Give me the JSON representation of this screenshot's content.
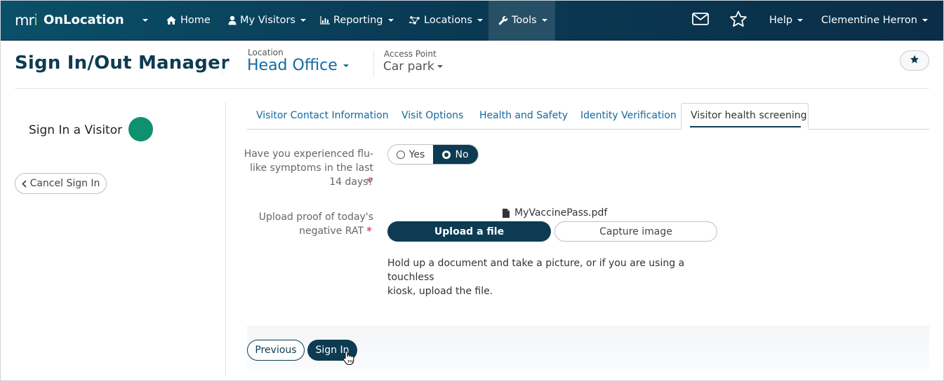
{
  "navbar": {
    "logo_text": "mri",
    "brand": "OnLocation",
    "items": [
      {
        "label": "Home",
        "icon": "home-icon"
      },
      {
        "label": "My Visitors",
        "icon": "user-icon"
      },
      {
        "label": "Reporting",
        "icon": "bar-chart-icon"
      },
      {
        "label": "Locations",
        "icon": "network-icon"
      },
      {
        "label": "Tools",
        "icon": "wrench-icon"
      }
    ],
    "help_label": "Help",
    "user_name": "Clementine Herron",
    "colors": {
      "bar_start": "#0a5068",
      "bar_end": "#0b2e48",
      "logo_accent": "#9cc65a"
    }
  },
  "header": {
    "title": "Sign In/Out Manager",
    "location_label": "Location",
    "location_value": "Head Office",
    "access_point_label": "Access Point",
    "access_point_value": "Car park",
    "favorite_icon": "star-icon"
  },
  "left_panel": {
    "heading": "Sign In a Visitor",
    "status_color": "#0f9170",
    "cancel_label": "Cancel Sign In"
  },
  "tabs": [
    {
      "label": "Visitor Contact Information",
      "active": false
    },
    {
      "label": "Visit Options",
      "active": false
    },
    {
      "label": "Health and Safety",
      "active": false
    },
    {
      "label": "Identity Verification",
      "active": false
    },
    {
      "label": "Visitor health screening",
      "active": true
    }
  ],
  "form": {
    "q1": {
      "line1": "Have you experienced flu-",
      "line2": "like symptoms in the last",
      "line3": "14 days?",
      "required_mark": "*",
      "options": [
        "Yes",
        "No"
      ],
      "selected": "No"
    },
    "q2": {
      "line1": "Upload proof of today's",
      "line2": "negative RAT",
      "required_mark": "*",
      "file_name": "MyVaccinePass.pdf",
      "upload_label": "Upload a file",
      "capture_label": "Capture image",
      "help_line1": "Hold up a document and take a picture, or if you are using a touchless",
      "help_line2": "kiosk, upload the file."
    }
  },
  "footer": {
    "previous_label": "Previous",
    "signin_label": "Sign In"
  },
  "theme": {
    "primary": "#0d3b52",
    "link": "#1369a0",
    "required": "#c2185b"
  }
}
